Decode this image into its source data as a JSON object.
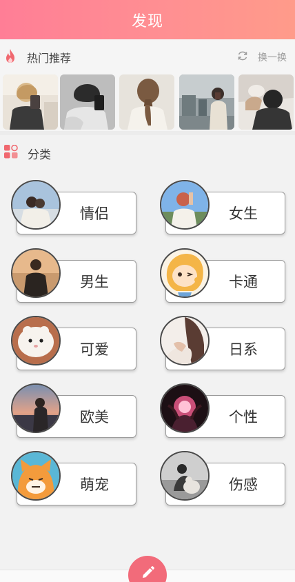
{
  "header": {
    "title": "发现"
  },
  "hot": {
    "icon": "flame-icon",
    "title": "热门推荐",
    "refresh_icon": "refresh-icon",
    "refresh_label": "换一换",
    "thumbnails": [
      {
        "name": "hot-thumb-1"
      },
      {
        "name": "hot-thumb-2"
      },
      {
        "name": "hot-thumb-3"
      },
      {
        "name": "hot-thumb-4"
      },
      {
        "name": "hot-thumb-5"
      }
    ]
  },
  "categories": {
    "icon": "category-grid-icon",
    "title": "分类",
    "items": [
      {
        "label": "情侣"
      },
      {
        "label": "女生"
      },
      {
        "label": "男生"
      },
      {
        "label": "卡通"
      },
      {
        "label": "可爱"
      },
      {
        "label": "日系"
      },
      {
        "label": "欧美"
      },
      {
        "label": "个性"
      },
      {
        "label": "萌宠"
      },
      {
        "label": "伤感"
      }
    ]
  },
  "fab": {
    "icon": "pencil-icon"
  },
  "colors": {
    "header_gradient_start": "#ff7e96",
    "header_gradient_end": "#ff9b8a",
    "fab": "#f26b7a",
    "accent_icon": "#f0686f"
  }
}
